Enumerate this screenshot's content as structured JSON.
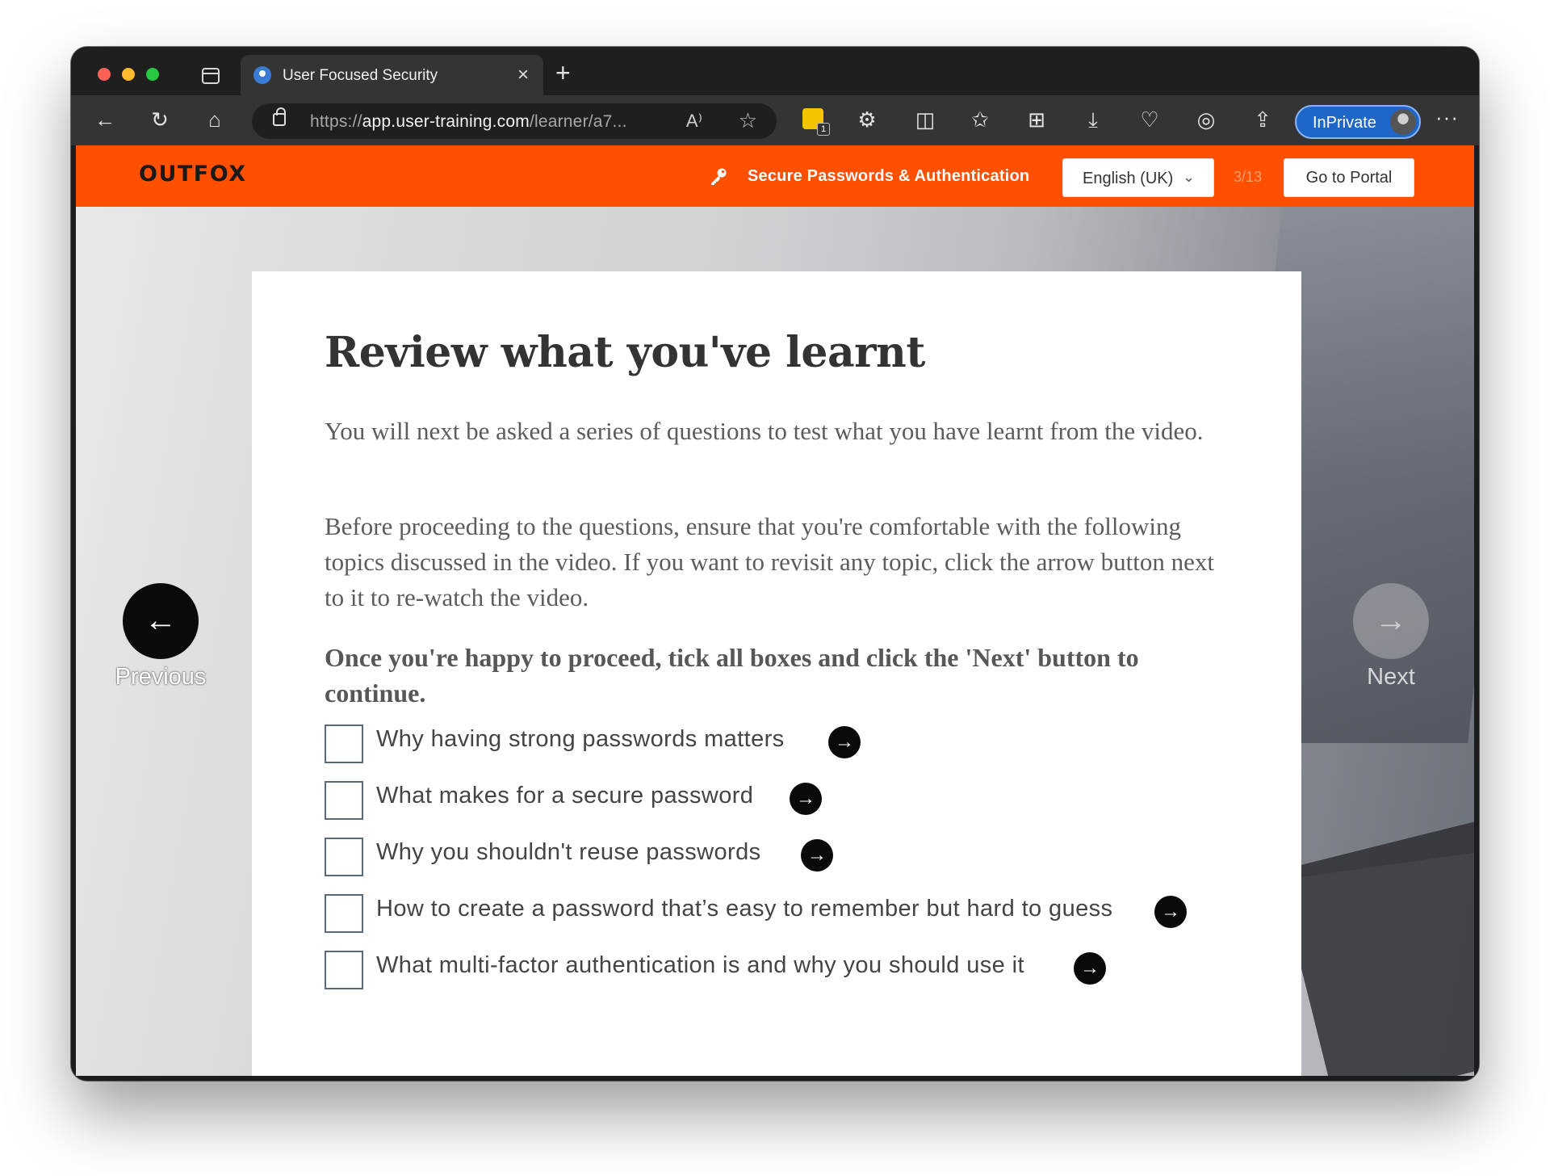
{
  "browser": {
    "tab_title": "User Focused Security",
    "tab_close_glyph": "×",
    "new_tab_glyph": "+",
    "address": {
      "scheme": "https://",
      "host": "app.user-training.com",
      "path": "/learner/a7...",
      "read_aloud_glyph": "A⁾",
      "favorite_glyph": "☆"
    },
    "extension_badge_count": "1",
    "inprivate_label": "InPrivate",
    "more_glyph": "···",
    "icons": {
      "back": "←",
      "reload": "↻",
      "home": "⌂",
      "extensions": "⚙",
      "split_screen": "◫",
      "favorites": "✩",
      "collections": "⊞",
      "downloads": "⤓",
      "health": "♡",
      "copilot": "◎",
      "share": "⇪"
    }
  },
  "header": {
    "logo": "OUTFOX",
    "course_title": "Secure Passwords & Authentication",
    "language": "English (UK)",
    "language_chevron": "⌄",
    "progress": "3/13",
    "portal_button": "Go to Portal",
    "accent_color": "#ff4f00"
  },
  "nav": {
    "previous_label": "Previous",
    "next_label": "Next",
    "arrow_left": "←",
    "arrow_right": "→"
  },
  "content": {
    "title": "Review what you've learnt",
    "para1": "You will next be asked a series of questions to test what you have learnt from the video.",
    "para2": "Before proceeding to the questions, ensure that you're comfortable with the following topics discussed in the video. If you want to revisit any topic, click the arrow button next to it to re-watch the video.",
    "instruction": "Once you're happy to proceed, tick all boxes and click the 'Next' button to continue.",
    "topic_arrow": "→",
    "topics": [
      {
        "label": "Why having strong passwords matters",
        "checked": false
      },
      {
        "label": "What makes for a secure password",
        "checked": false
      },
      {
        "label": "Why you shouldn't reuse passwords",
        "checked": false
      },
      {
        "label": "How to create a password that’s easy to remember but hard to guess",
        "checked": false
      },
      {
        "label": "What multi-factor authentication is and why you should use it",
        "checked": false
      }
    ]
  }
}
